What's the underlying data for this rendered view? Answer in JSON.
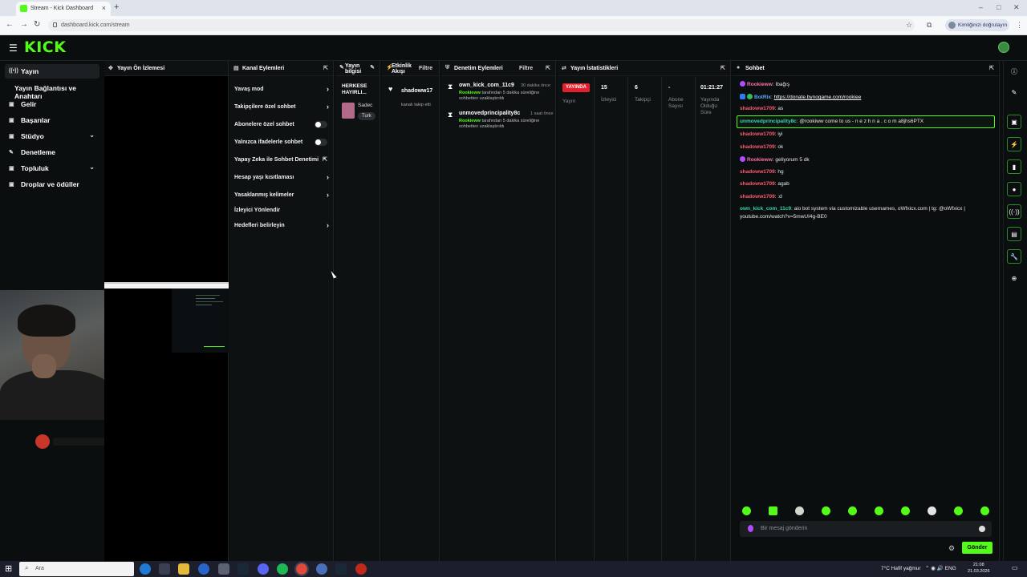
{
  "browser": {
    "tab_title": "Stream - Kick Dashboard",
    "url": "dashboard.kick.com/stream",
    "profile_label": "Kimliğinizi doğrulayın"
  },
  "app": {
    "logo": "KICK",
    "brand_color": "#53fc18"
  },
  "sidebar": {
    "items": [
      {
        "label": "Yayın",
        "icon": "broadcast-icon"
      },
      {
        "label": "Yayın Bağlantısı ve Anahtarı",
        "icon": ""
      },
      {
        "label": "Gelir",
        "icon": "dollar-icon"
      },
      {
        "label": "Başarılar",
        "icon": "trophy-icon"
      },
      {
        "label": "Stüdyo",
        "icon": "studio-icon"
      },
      {
        "label": "Denetleme",
        "icon": "wrench-icon"
      },
      {
        "label": "Topluluk",
        "icon": "community-icon"
      },
      {
        "label": "Droplar ve ödüller",
        "icon": "gift-icon"
      }
    ]
  },
  "panels": {
    "preview": {
      "title": "Yayın Ön İzlemesi"
    },
    "actions": {
      "title": "Kanal Eylemleri",
      "items": [
        {
          "label": "Yavaş mod",
          "control": "chevron"
        },
        {
          "label": "Takipçilere özel sohbet",
          "control": "chevron"
        },
        {
          "label": "Abonelere özel sohbet",
          "control": "toggle"
        },
        {
          "label": "Yalnızca ifadelerle sohbet",
          "control": "toggle"
        },
        {
          "label": "Yapay Zeka ile Sohbet Denetimi",
          "control": "external"
        },
        {
          "label": "Hesap yaşı kısıtlaması",
          "control": "chevron"
        },
        {
          "label": "Yasaklanmış kelimeler",
          "control": "chevron"
        },
        {
          "label": "İzleyici Yönlendir",
          "control": "none"
        },
        {
          "label": "Hedefleri belirleyin",
          "control": "chevron"
        }
      ]
    },
    "info": {
      "title_line1": "Yayın",
      "title_line2": "bilgisi",
      "stream_title": "HERKESE HAYIRLI...",
      "category": "Sadec",
      "tag": "Turk"
    },
    "events": {
      "title_line1": "Etkinlik",
      "title_line2": "Akışı",
      "filter": "Filtre",
      "user": "shadoww17",
      "text": "kanalı takip etti"
    },
    "moderation": {
      "title": "Denetim Eylemleri",
      "filter": "Filtre",
      "rows": [
        {
          "user": "own_kick_com_11c9",
          "time": "30 dakika önce",
          "mod": "Rookieww",
          "desc": "tarafından 5 dakika süreliğine sohbetten uzaklaştırıldı"
        },
        {
          "user": "unmovedprincipality8c",
          "time": "1 saat önce",
          "mod": "Rookieww",
          "desc": "tarafından 5 dakika süreliğine sohbetten uzaklaştırıldı"
        }
      ]
    },
    "stats": {
      "title": "Yayın İstatistikleri",
      "live_badge": "YAYINDA",
      "live_label": "Yayın",
      "viewers": "15",
      "viewers_label": "İzleyici",
      "followers": "6",
      "followers_label": "Takipçi",
      "subs": "-",
      "subs_label_1": "Abone",
      "subs_label_2": "Sayısı",
      "duration": "01:21:27",
      "duration_label_1": "Yayında",
      "duration_label_2": "Olduğu",
      "duration_label_3": "Süre"
    },
    "chat": {
      "title": "Sohbet",
      "messages": [
        {
          "user": "Rookieww",
          "text": ": Ibağış"
        },
        {
          "user": "BotRix",
          "text": ": ",
          "link": "https://donate.bynogame.com/rookiee"
        },
        {
          "user": "shadoww1709",
          "text": ": as"
        },
        {
          "user": "unmovedprincipality8c",
          "text": ": @rookiww come to us - n e z h n a . c o m a8jhs6PTX"
        },
        {
          "user": "shadoww1709",
          "text": ": iyi"
        },
        {
          "user": "shadoww1709",
          "text": ": ok"
        },
        {
          "user": "Rookieww",
          "text": ": geliyorum 5 dk"
        },
        {
          "user": "shadoww1709",
          "text": ": hg"
        },
        {
          "user": "shadoww1709",
          "text": ": agab"
        },
        {
          "user": "shadoww1709",
          "text": ": :d"
        },
        {
          "user": "own_kick_com_11c9",
          "text": ": aio bot system via customizable usernames, oWfxicx.com | tg: @oWfxicx |"
        },
        {
          "user": "",
          "text": "youtube.com/watch?v=5mwUI4g-BE0"
        }
      ],
      "input_placeholder": "Bir mesaj gönderin",
      "send_label": "Gönder"
    }
  },
  "taskbar": {
    "search_placeholder": "Ara",
    "weather": "7°C  Hafif yağmur",
    "lang": "ENG",
    "time": "21:08",
    "date": "21.03.2026"
  }
}
